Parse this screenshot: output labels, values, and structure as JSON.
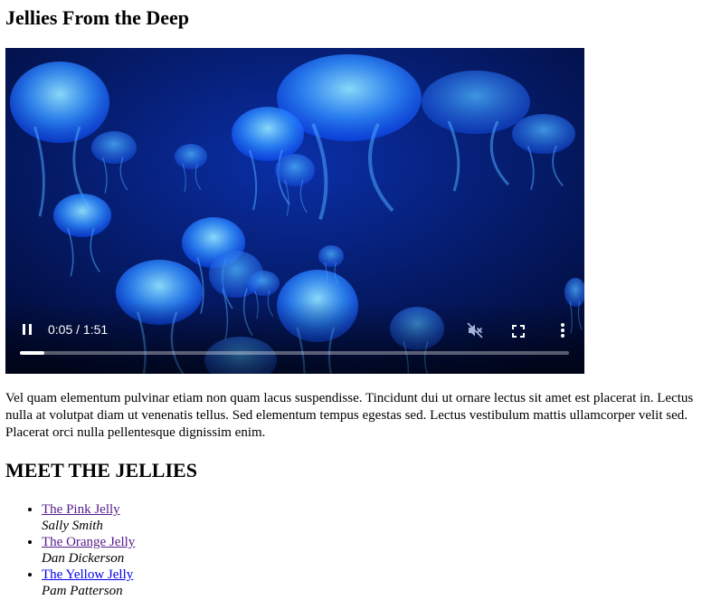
{
  "page": {
    "title": "Jellies From the Deep",
    "intro": "Vel quam elementum pulvinar etiam non quam lacus suspendisse. Tincidunt dui ut ornare lectus sit amet est placerat in. Lectus nulla at volutpat diam ut venenatis tellus. Sed elementum tempus egestas sed. Lectus vestibulum mattis ullamcorper velit sed. Placerat orci nulla pellentesque dignissim enim.",
    "section_heading": "MEET THE JELLIES"
  },
  "video": {
    "state": "playing",
    "time_display": "0:05 / 1:51",
    "current_seconds": 5,
    "duration_seconds": 111,
    "muted": true,
    "icons": {
      "play_pause": "pause-icon",
      "volume": "volume-muted-icon",
      "fullscreen": "fullscreen-icon",
      "menu": "more-vertical-icon"
    },
    "colors": {
      "background": "#00134a",
      "jelly": "#3fa6ff",
      "jelly_glow": "#7fd4ff"
    }
  },
  "jellies": [
    {
      "name": "The Pink Jelly",
      "author": "Sally Smith",
      "link_color": "#551a8b"
    },
    {
      "name": "The Orange Jelly",
      "author": "Dan Dickerson",
      "link_color": "#551a8b"
    },
    {
      "name": "The Yellow Jelly",
      "author": "Pam Patterson",
      "link_color": "#0000ee"
    }
  ]
}
